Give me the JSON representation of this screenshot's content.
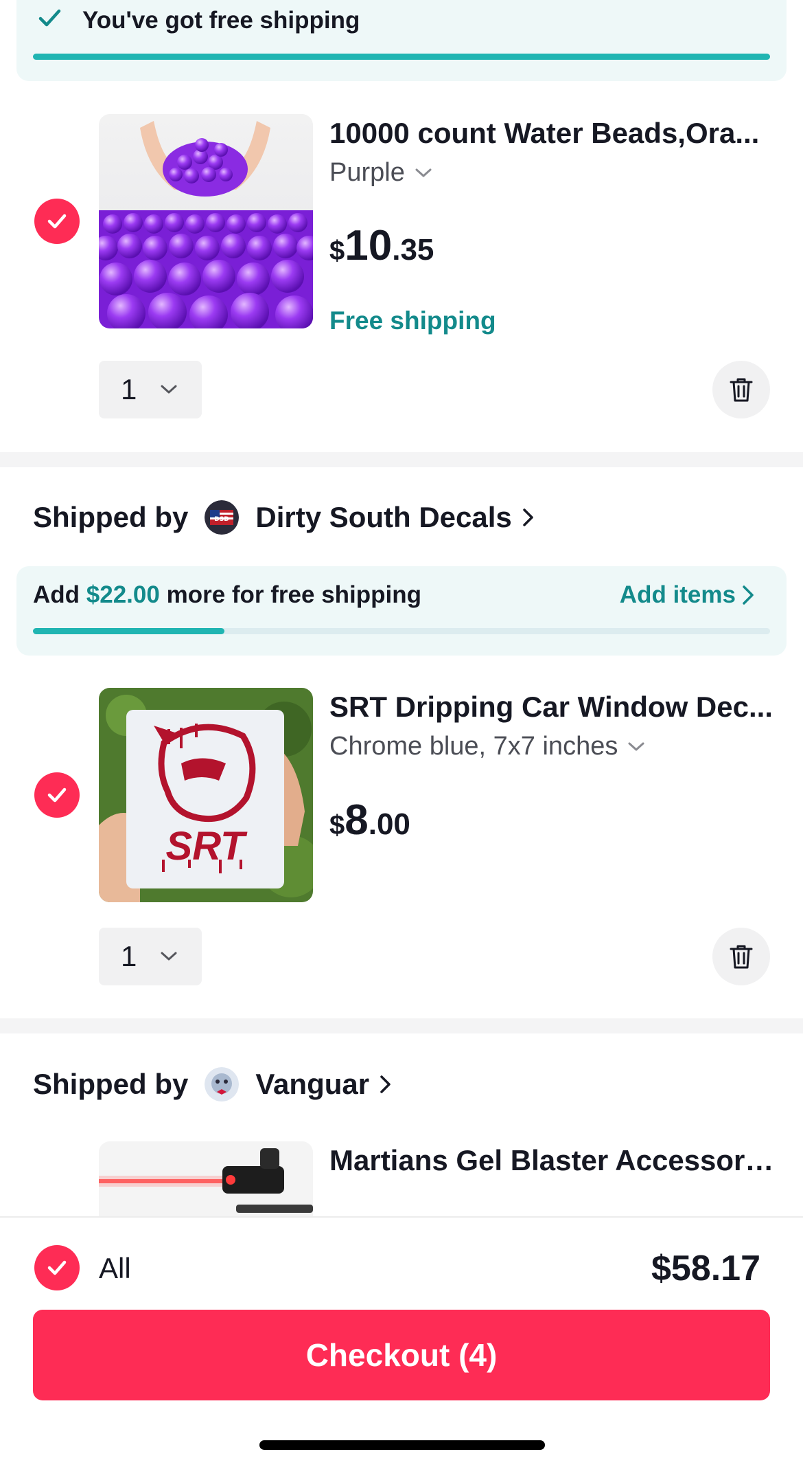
{
  "colors": {
    "accent": "#fe2c55",
    "teal": "#138a8b",
    "progress": "#20b5b2",
    "banner_bg": "#eef8f8"
  },
  "top_banner": {
    "icon": "checkmark-icon",
    "message": "You've got free shipping",
    "progress_fraction": 1.0
  },
  "items": [
    {
      "title": "10000 count Water Beads,Ora...",
      "variant": "Purple",
      "price_currency": "$",
      "price_whole": "10",
      "price_cents": ".35",
      "shipping": "Free shipping",
      "quantity": "1",
      "selected": true
    },
    {
      "title": "SRT Dripping Car Window Dec...",
      "variant": "Chrome blue, 7x7 inches",
      "price_currency": "$",
      "price_whole": "8",
      "price_cents": ".00",
      "quantity": "1",
      "selected": true
    },
    {
      "title": "Martians Gel Blaster Accessori..."
    }
  ],
  "sellers": [
    {
      "label": "Shipped by",
      "name": "Dirty South Decals"
    },
    {
      "label": "Shipped by",
      "name": "Vanguar"
    }
  ],
  "mid_banner": {
    "prefix": "Add",
    "amount": "$22.00",
    "suffix": "more for free shipping",
    "action": "Add items",
    "progress_fraction": 0.26
  },
  "bottom_bar": {
    "all_label": "All",
    "total": "$58.17",
    "checkout_label": "Checkout (4)"
  }
}
